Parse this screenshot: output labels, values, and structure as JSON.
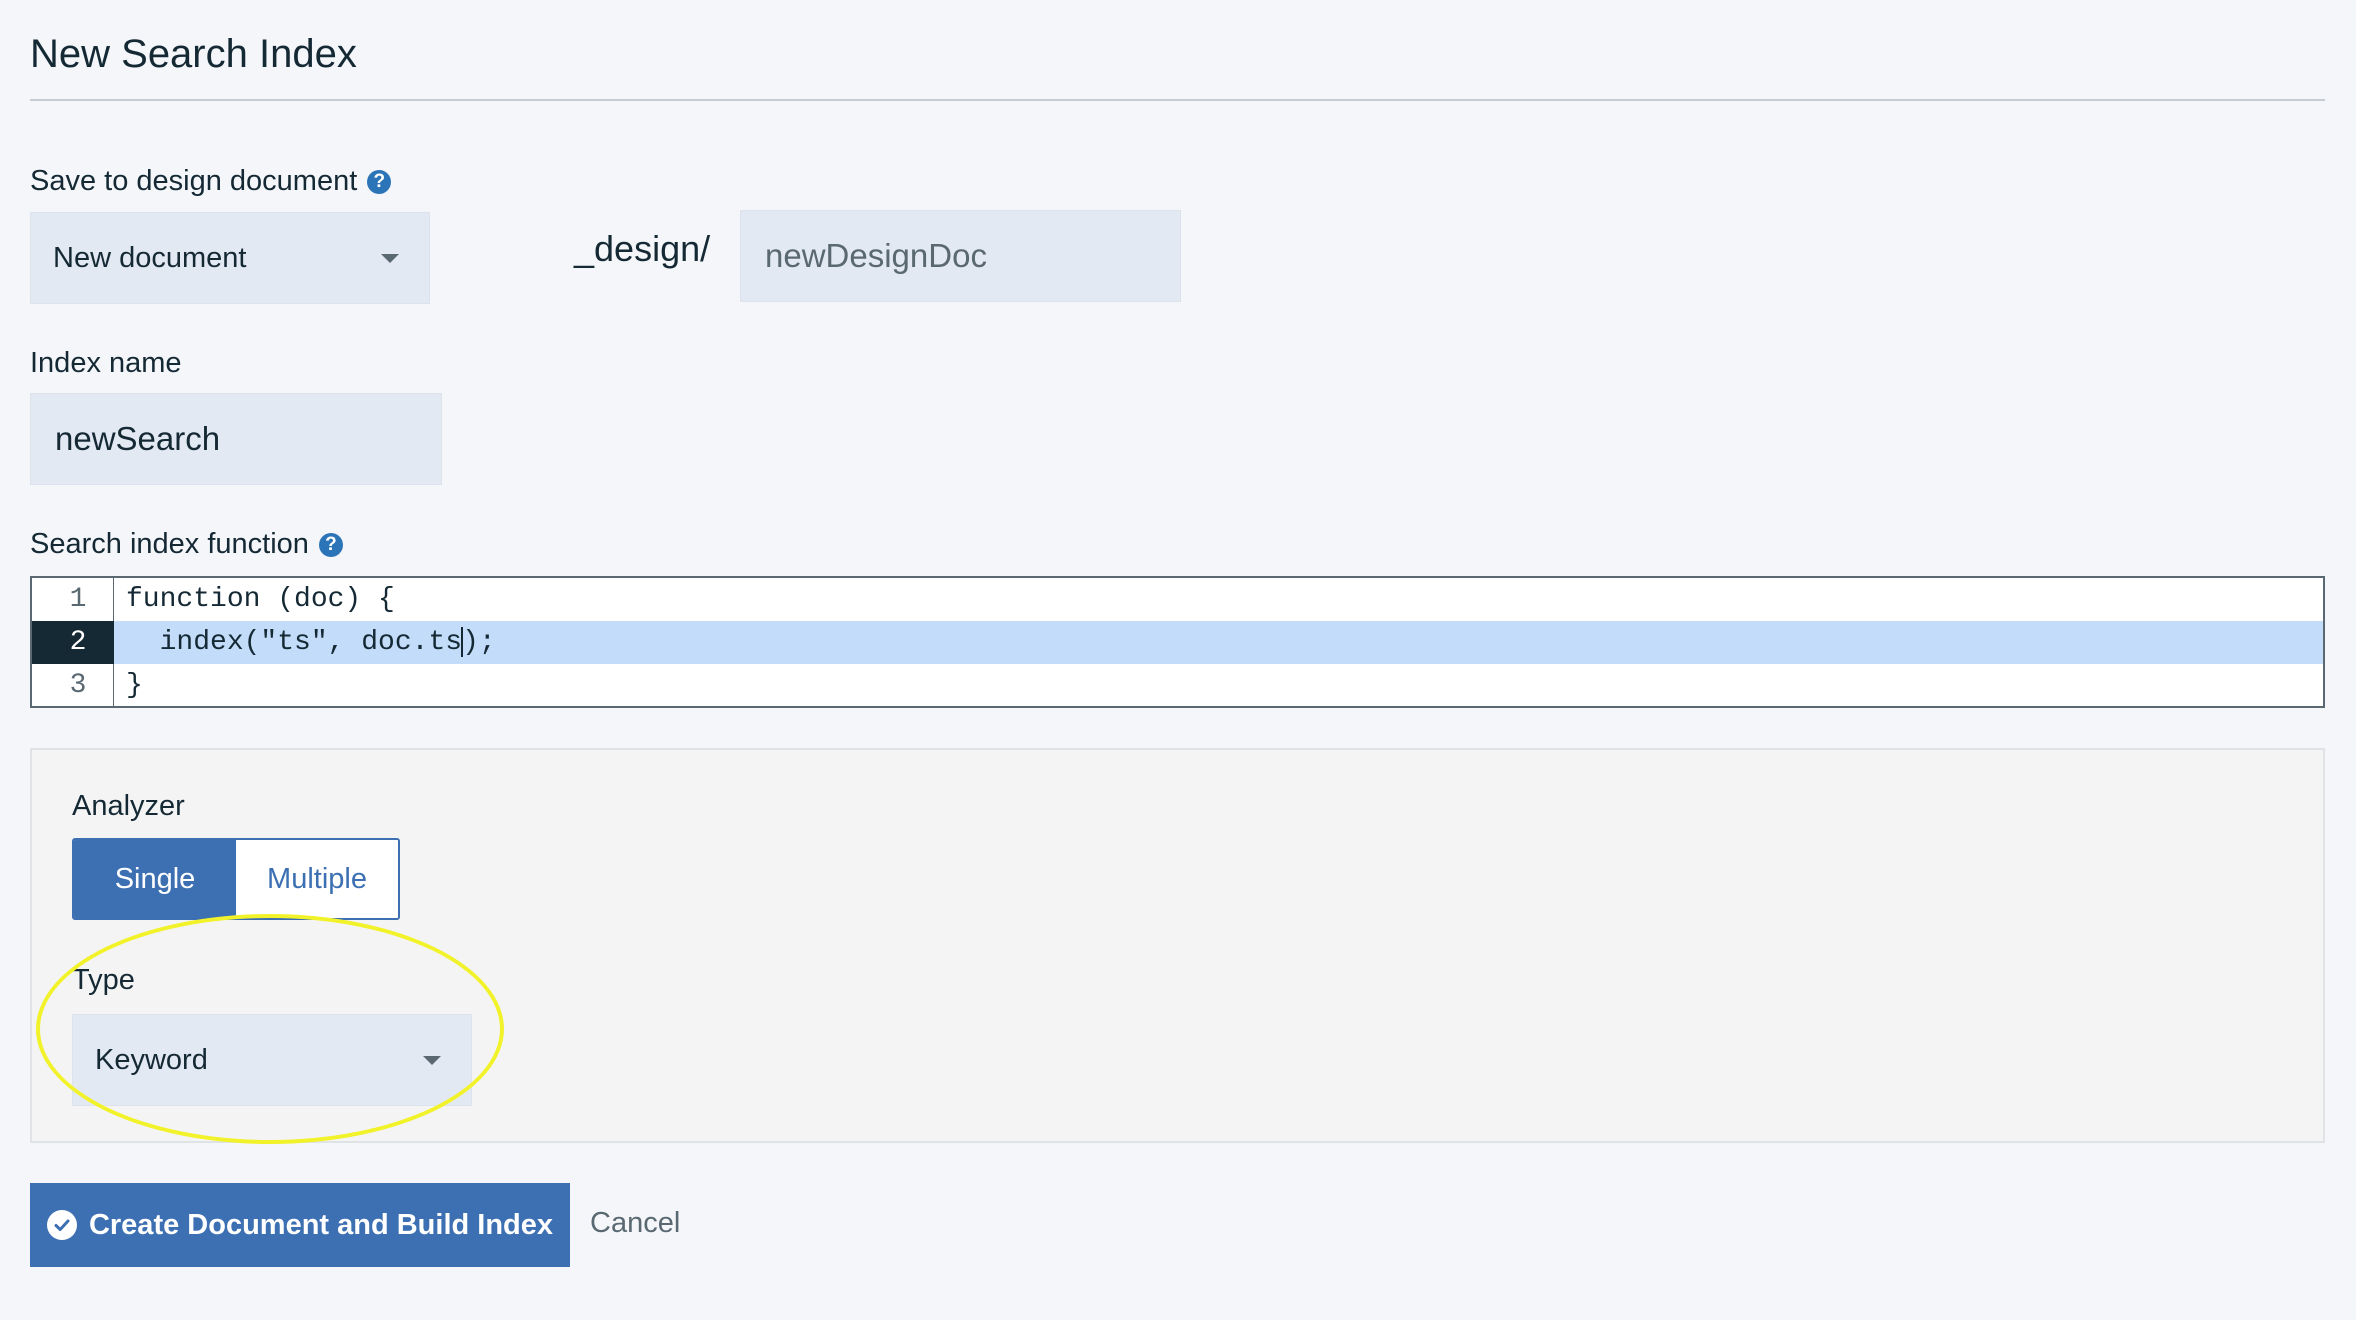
{
  "page": {
    "title": "New Search Index"
  },
  "design_doc": {
    "label": "Save to design document",
    "select_value": "New document",
    "prefix": "_design/",
    "name_placeholder": "newDesignDoc"
  },
  "index_name": {
    "label": "Index name",
    "value": "newSearch"
  },
  "search_function": {
    "label": "Search index function",
    "lines": [
      {
        "number": "1",
        "text": "function (doc) {"
      },
      {
        "number": "2",
        "text_before_cursor": "  index(\"ts\", doc.ts",
        "text_after_cursor": ");"
      },
      {
        "number": "3",
        "text": "}"
      }
    ],
    "active_line": 2
  },
  "analyzer": {
    "label": "Analyzer",
    "options": [
      "Single",
      "Multiple"
    ],
    "selected": "Single",
    "type_label": "Type",
    "type_value": "Keyword"
  },
  "actions": {
    "create_label": "Create Document and Build Index",
    "cancel_label": "Cancel"
  },
  "colors": {
    "primary": "#3d70b2",
    "active_line_bg": "#c2dcf9",
    "highlight_annotation": "#f2f22a"
  },
  "icons": {
    "help": "question-circle-icon",
    "caret": "chevron-down-icon",
    "submit": "check-circle-icon"
  }
}
